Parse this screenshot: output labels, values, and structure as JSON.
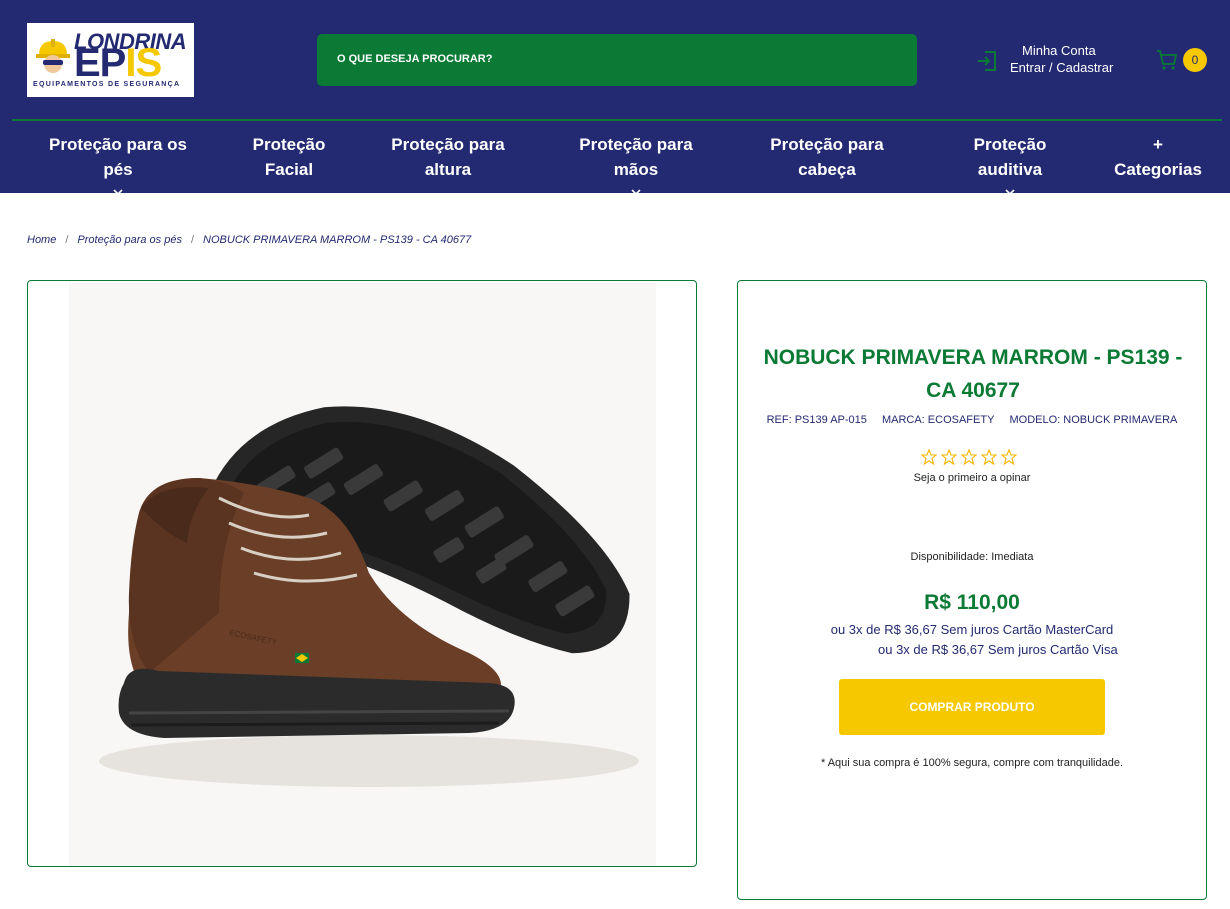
{
  "brand": {
    "line1": "LONDRINA",
    "line2_a": "EP",
    "line2_b": "I",
    "line2_c": "S",
    "tagline": "EQUIPAMENTOS DE SEGURANÇA"
  },
  "search": {
    "placeholder": "O QUE DESEJA PROCURAR?"
  },
  "account": {
    "title": "Minha Conta",
    "subtitle": "Entrar / Cadastrar",
    "icon": "login-icon"
  },
  "cart": {
    "count": "0",
    "icon": "cart-icon"
  },
  "nav": [
    {
      "line1": "Proteção para os pés",
      "line2": "",
      "dropdown": true
    },
    {
      "line1": "Proteção",
      "line2": "Facial",
      "dropdown": false
    },
    {
      "line1": "Proteção para",
      "line2": "altura",
      "dropdown": false
    },
    {
      "line1": "Proteção para mãos",
      "line2": "",
      "dropdown": true
    },
    {
      "line1": "Proteção para",
      "line2": "cabeça",
      "dropdown": false
    },
    {
      "line1": "Proteção auditiva",
      "line2": "",
      "dropdown": true
    },
    {
      "line1": "+",
      "line2": "Categorias",
      "dropdown": false
    }
  ],
  "breadcrumb": [
    "Home",
    "Proteção para os pés",
    "NOBUCK PRIMAVERA MARROM - PS139 - CA 40677"
  ],
  "product": {
    "title": "NOBUCK PRIMAVERA MARROM - PS139 - CA 40677",
    "ref": "REF:   PS139 AP-015",
    "brand": "MARCA: ECOSAFETY",
    "model": "MODELO: NOBUCK PRIMAVERA",
    "rating": 0,
    "opinion": "Seja o primeiro a opinar",
    "availability": "Disponibilidade: Imediata",
    "price": "R$ 110,00",
    "installment_1": "ou 3x de R$ 36,67 Sem juros Cartão MasterCard",
    "installment_2": "ou 3x de R$ 36,67 Sem juros Cartão Visa",
    "buy_label": "COMPRAR PRODUTO",
    "secure_note": "* Aqui sua compra é 100% segura, compre com tranquilidade.",
    "boot_engraving": "ECOSAFETY"
  },
  "colors": {
    "header_bg": "#232a72",
    "green": "#0a7a34",
    "yellow": "#f6c800"
  }
}
